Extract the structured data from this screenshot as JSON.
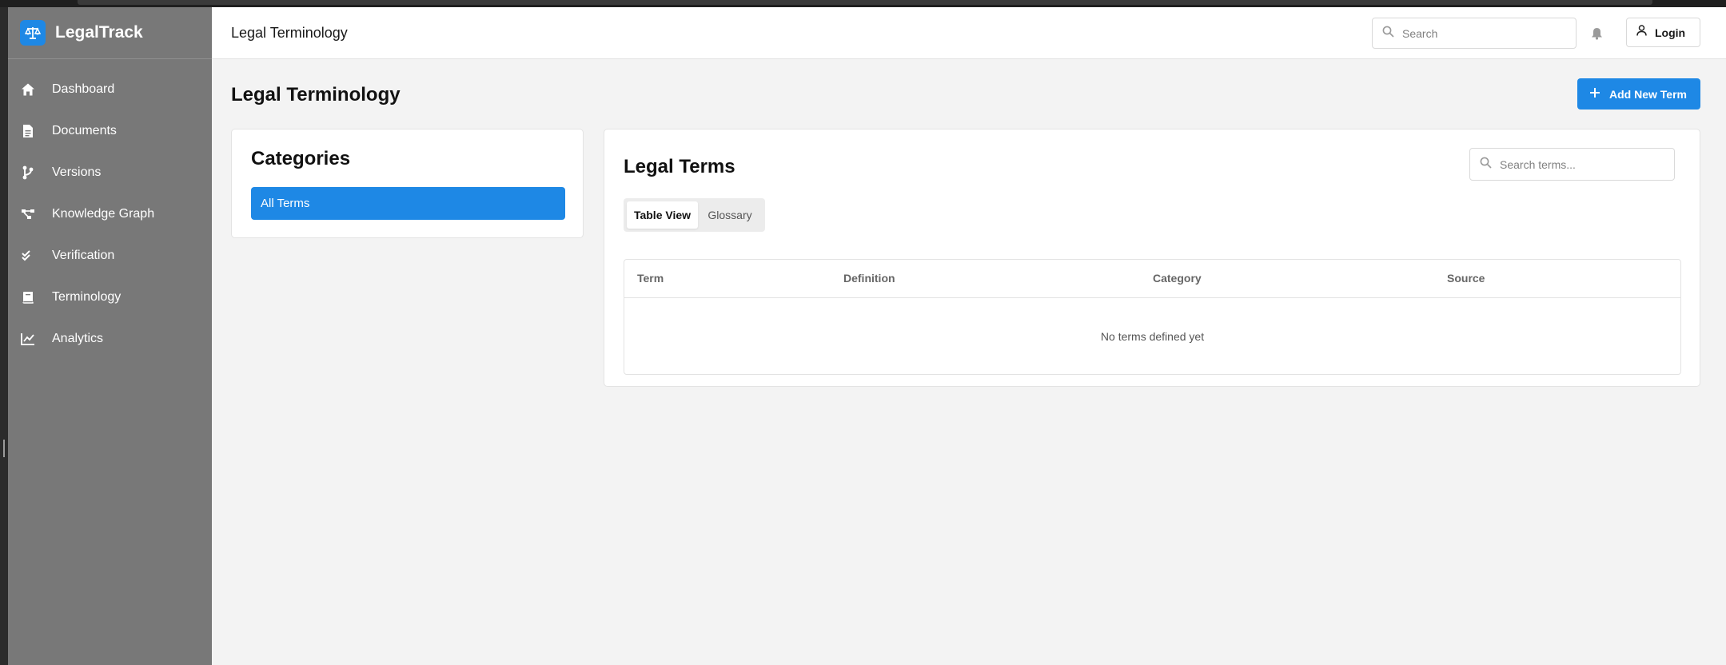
{
  "app": {
    "name": "LegalTrack",
    "logo_icon": "scale-icon",
    "accent_color": "#1e88e5",
    "sidebar_color": "#787878"
  },
  "sidebar": {
    "items": [
      {
        "label": "Dashboard",
        "icon": "home-icon"
      },
      {
        "label": "Documents",
        "icon": "document-icon"
      },
      {
        "label": "Versions",
        "icon": "branch-icon"
      },
      {
        "label": "Knowledge Graph",
        "icon": "graph-icon"
      },
      {
        "label": "Verification",
        "icon": "check-double-icon"
      },
      {
        "label": "Terminology",
        "icon": "book-icon"
      },
      {
        "label": "Analytics",
        "icon": "line-chart-icon"
      }
    ]
  },
  "header": {
    "title": "Legal Terminology",
    "search_placeholder": "Search",
    "login_label": "Login"
  },
  "page": {
    "title": "Legal Terminology",
    "add_button_label": "Add New Term"
  },
  "categories": {
    "title": "Categories",
    "items": [
      {
        "label": "All Terms",
        "selected": true
      }
    ]
  },
  "terms": {
    "title": "Legal Terms",
    "search_placeholder": "Search terms...",
    "tabs": [
      {
        "label": "Table View",
        "active": true
      },
      {
        "label": "Glossary",
        "active": false
      }
    ],
    "columns": [
      "Term",
      "Definition",
      "Category",
      "Source"
    ],
    "rows": [],
    "empty_message": "No terms defined yet"
  }
}
